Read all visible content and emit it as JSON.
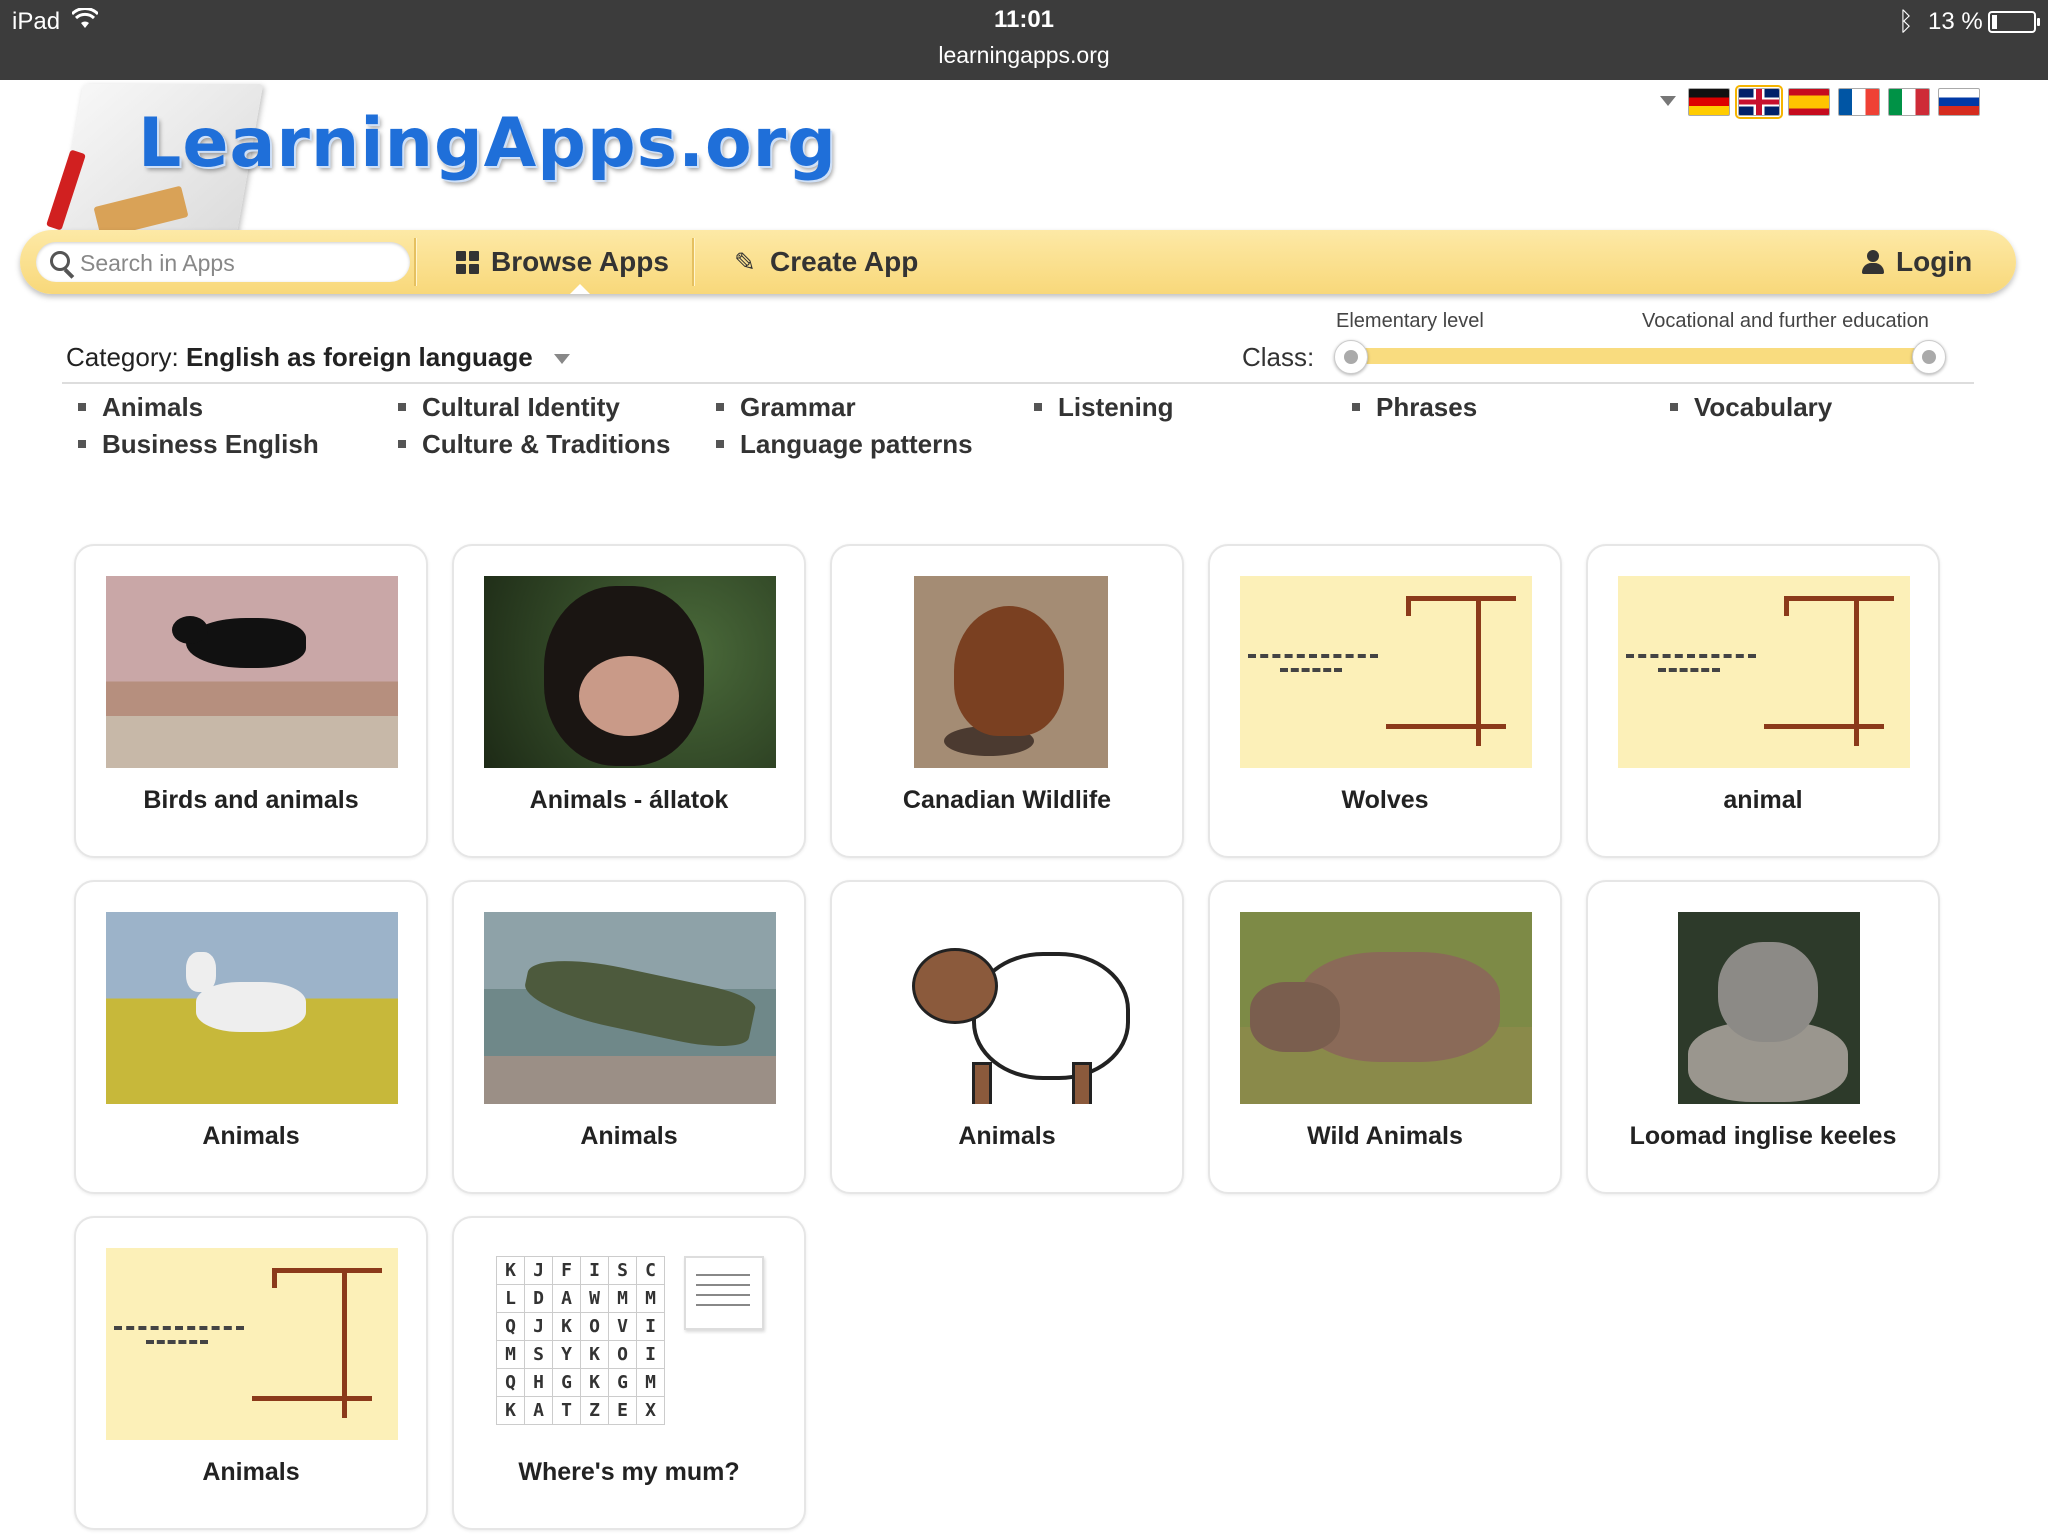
{
  "status_bar": {
    "device": "iPad",
    "time": "11:01",
    "url": "learningapps.org",
    "battery": "13 %",
    "battery_level": 0.13,
    "icons": [
      "wifi-icon",
      "bluetooth-icon",
      "battery-icon"
    ]
  },
  "logo": {
    "text": "LearningApps.org"
  },
  "languages": {
    "flags": [
      {
        "name": "german-flag-icon",
        "active": false
      },
      {
        "name": "english-flag-icon",
        "active": true
      },
      {
        "name": "spanish-flag-icon",
        "active": false
      },
      {
        "name": "french-flag-icon",
        "active": false
      },
      {
        "name": "italian-flag-icon",
        "active": false
      },
      {
        "name": "russian-flag-icon",
        "active": false
      }
    ]
  },
  "nav": {
    "search_placeholder": "Search in Apps",
    "browse_label": "Browse Apps",
    "create_label": "Create App",
    "login_label": "Login",
    "bar_color": "#f8d87a"
  },
  "filters": {
    "category_prefix": "Category:",
    "category_value": "English as foreign language",
    "class_label": "Class:",
    "level_min_label": "Elementary level",
    "level_max_label": "Vocational and further education"
  },
  "subcategories": [
    "Animals",
    "Business English",
    "Cultural Identity",
    "Culture & Traditions",
    "Grammar",
    "Language patterns",
    "Listening",
    "Phrases",
    "Vocabulary"
  ],
  "apps": [
    {
      "title": "Birds and animals"
    },
    {
      "title": "Animals - állatok"
    },
    {
      "title": "Canadian Wildlife"
    },
    {
      "title": "Wolves"
    },
    {
      "title": "animal"
    },
    {
      "title": "Animals"
    },
    {
      "title": "Animals"
    },
    {
      "title": "Animals"
    },
    {
      "title": "Wild Animals"
    },
    {
      "title": "Loomad inglise keeles"
    },
    {
      "title": "Animals"
    },
    {
      "title": "Where's my mum?"
    }
  ],
  "wordsearch": {
    "rows": [
      "KJFISC",
      "LDAWMM",
      "QJKOVI",
      "MSYKOI",
      "QHGKGM",
      "KATZEX"
    ]
  }
}
